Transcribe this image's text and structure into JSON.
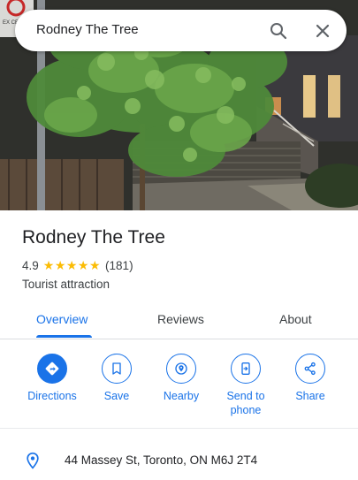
{
  "search": {
    "query": "Rodney The Tree"
  },
  "place": {
    "name": "Rodney The Tree",
    "rating": "4.9",
    "stars": "★★★★★",
    "review_count": "(181)",
    "category": "Tourist attraction",
    "photo_sign_text": "EX CEPT"
  },
  "tabs": [
    {
      "label": "Overview",
      "active": true
    },
    {
      "label": "Reviews",
      "active": false
    },
    {
      "label": "About",
      "active": false
    }
  ],
  "actions": [
    {
      "label": "Directions",
      "icon": "directions-icon"
    },
    {
      "label": "Save",
      "icon": "bookmark-icon"
    },
    {
      "label": "Nearby",
      "icon": "nearby-icon"
    },
    {
      "label": "Send to phone",
      "icon": "send-to-phone-icon"
    },
    {
      "label": "Share",
      "icon": "share-icon"
    }
  ],
  "address": {
    "text": "44 Massey St, Toronto, ON M6J 2T4",
    "icon": "location-pin-icon"
  },
  "colors": {
    "accent": "#1a73e8",
    "star": "#fbbc04",
    "text": "#202124"
  }
}
